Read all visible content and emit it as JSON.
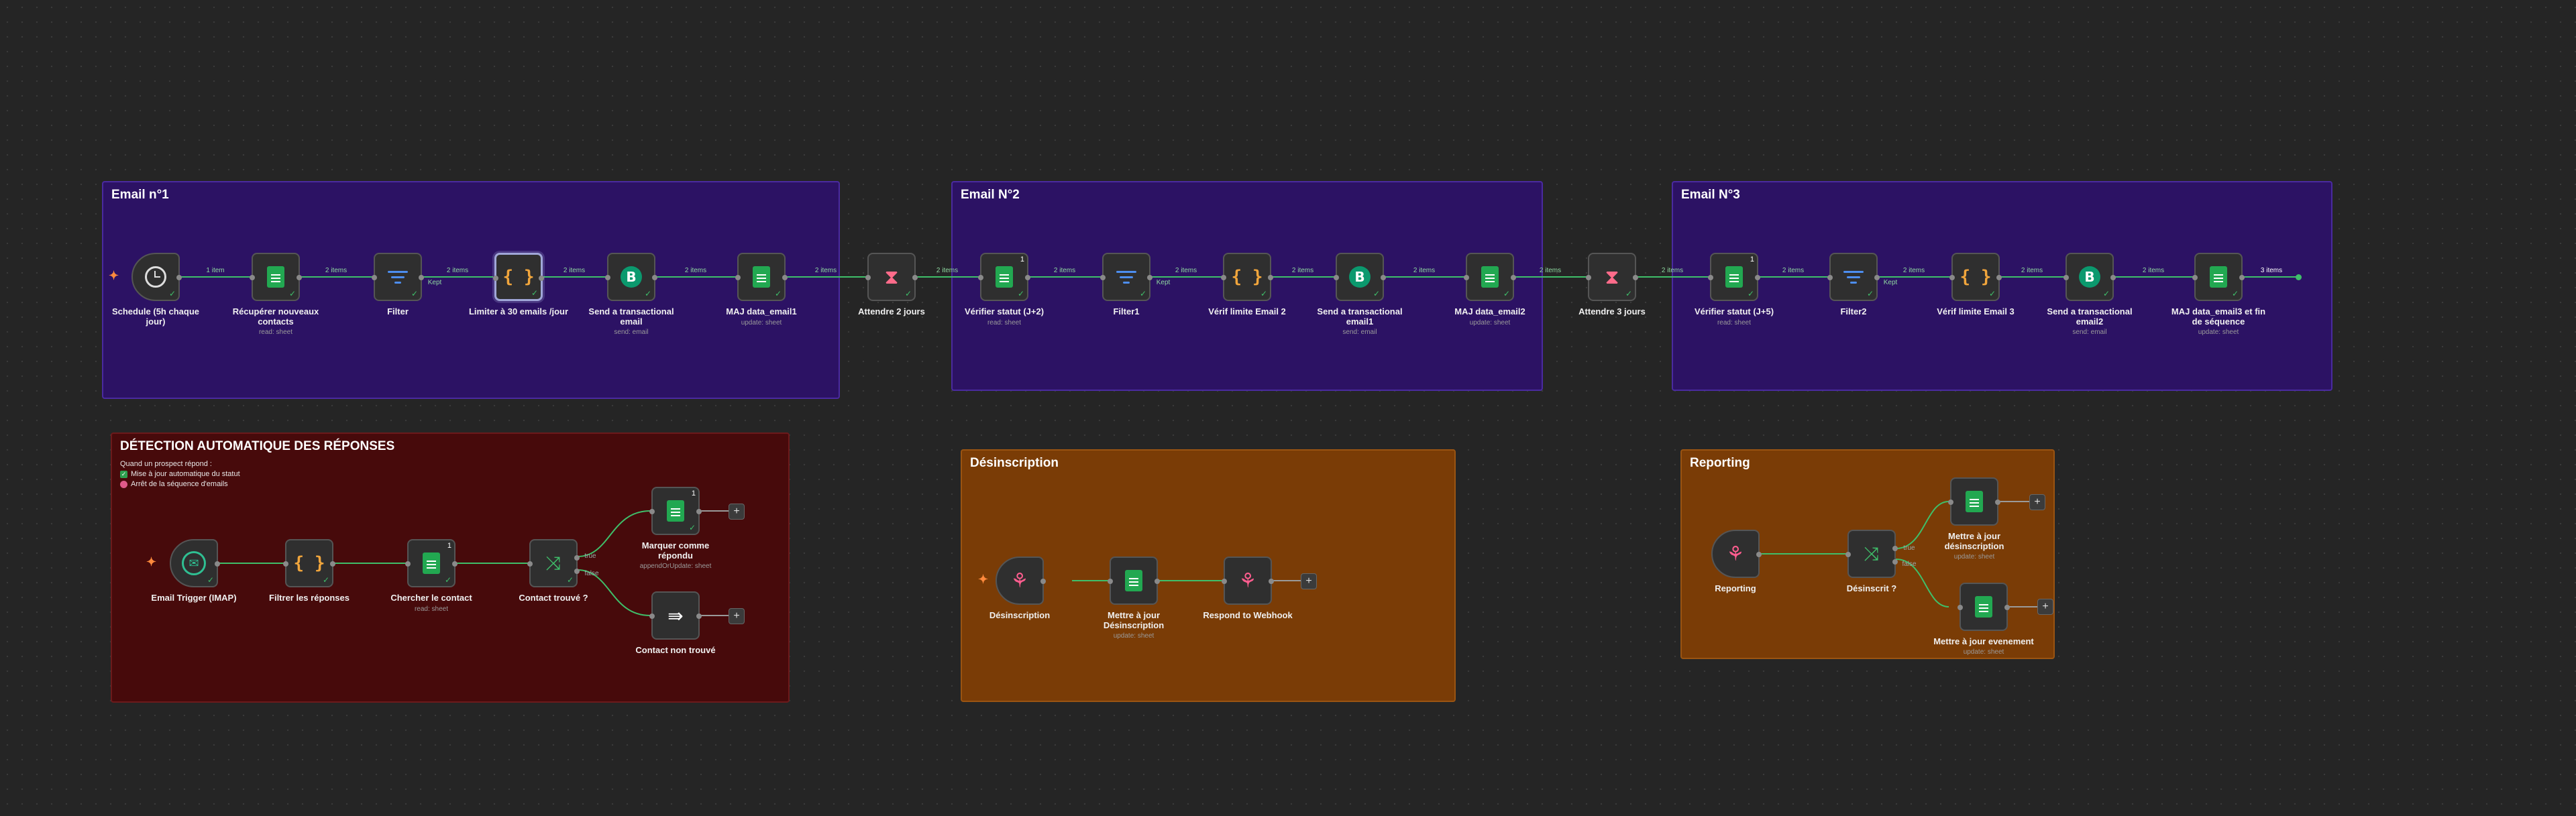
{
  "stickies": {
    "email1": "Email n°1",
    "email2": "Email N°2",
    "email3": "Email N°3",
    "detection": "DÉTECTION AUTOMATIQUE DES RÉPONSES",
    "detection_notes": [
      "Quand un prospect répond :",
      "Mise à jour automatique du statut",
      "Arrêt de la séquence d'emails"
    ],
    "desinscription": "Désinscription",
    "reporting": "Reporting"
  },
  "nodes": {
    "schedule": {
      "label": "Schedule (5h chaque jour)"
    },
    "recup": {
      "label": "Récupérer nouveaux contacts",
      "sub": "read: sheet"
    },
    "filter": {
      "label": "Filter"
    },
    "limiter": {
      "label": "Limiter à 30 emails /jour"
    },
    "send1": {
      "label": "Send a transactional email",
      "sub": "send: email"
    },
    "maj1": {
      "label": "MAJ data_email1",
      "sub": "update: sheet"
    },
    "wait2": {
      "label": "Attendre 2 jours"
    },
    "verif2": {
      "label": "Vérifier statut (J+2)",
      "sub": "read: sheet",
      "badge": "1"
    },
    "filter1": {
      "label": "Filter1"
    },
    "limit2": {
      "label": "Vérif limite Email 2"
    },
    "send2": {
      "label": "Send a transactional email1",
      "sub": "send: email"
    },
    "maj2": {
      "label": "MAJ data_email2",
      "sub": "update: sheet"
    },
    "wait3": {
      "label": "Attendre 3 jours"
    },
    "verif5": {
      "label": "Vérifier statut (J+5)",
      "sub": "read: sheet",
      "badge": "1"
    },
    "filter2": {
      "label": "Filter2"
    },
    "limit3": {
      "label": "Vérif limite Email 3"
    },
    "send3": {
      "label": "Send a transactional email2",
      "sub": "send: email"
    },
    "maj3": {
      "label": "MAJ data_email3 et fin de séquence",
      "sub": "update: sheet"
    },
    "imap": {
      "label": "Email Trigger (IMAP)"
    },
    "filtrer": {
      "label": "Filtrer les réponses"
    },
    "chercher": {
      "label": "Chercher le contact",
      "sub": "read: sheet",
      "badge": "1"
    },
    "trouve": {
      "label": "Contact trouvé ?"
    },
    "marquer": {
      "label": "Marquer comme répondu",
      "sub": "appendOrUpdate: sheet",
      "badge": "1"
    },
    "nontrouve": {
      "label": "Contact non trouvé"
    },
    "desinscription": {
      "label": "Désinscription"
    },
    "majdes": {
      "label": "Mettre à jour Désinscription",
      "sub": "update: sheet"
    },
    "respond": {
      "label": "Respond to Webhook"
    },
    "reporting": {
      "label": "Reporting"
    },
    "desinscrit": {
      "label": "Désinscrit ?"
    },
    "majdes2": {
      "label": "Mettre à jour désinscription",
      "sub": "update: sheet"
    },
    "majevt": {
      "label": "Mettre à jour evenement",
      "sub": "update: sheet"
    }
  },
  "edges": {
    "item1": "1 item",
    "items2": "2 items",
    "items3": "3 items",
    "true": "true",
    "false": "false",
    "kept": "Kept"
  },
  "colors": {
    "sticky_purple": "#2c1264",
    "sticky_red": "#470a0b",
    "sticky_orange": "#7a3c06",
    "wire_success": "#3fbf6a",
    "wire_default": "#9a9a9a",
    "canvas": "#252525"
  }
}
